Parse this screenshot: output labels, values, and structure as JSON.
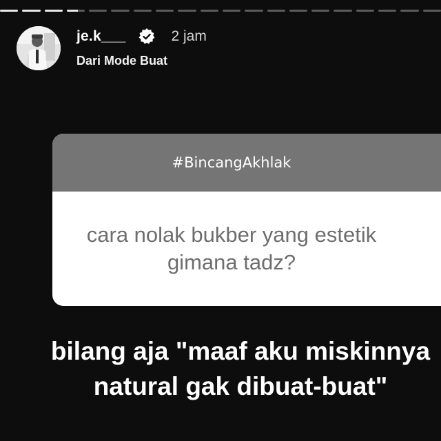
{
  "progress": {
    "segments": [
      1,
      1,
      1,
      1,
      1,
      1,
      1,
      1,
      1,
      1,
      1,
      1,
      1,
      1,
      1,
      1,
      1,
      1,
      1,
      1
    ],
    "filled_segments": 3,
    "current_segment_fill": 0.6
  },
  "header": {
    "username": "je.k___",
    "time": "2 jam",
    "subtitle": "Dari Mode Buat",
    "verified_icon": "verified-badge-icon"
  },
  "question_card": {
    "tag": "#BincangAkhlak",
    "question": "cara nolak bukber yang estetik gimana tadz?"
  },
  "caption": {
    "line1": "bilang aja \"maaf aku miskinnya",
    "line2": "natural gak dibuat-buat\""
  },
  "colors": {
    "background": "#0d0d0d",
    "card_header": "#757575",
    "card_body": "#ffffff",
    "question_text": "#6e6e6e"
  }
}
